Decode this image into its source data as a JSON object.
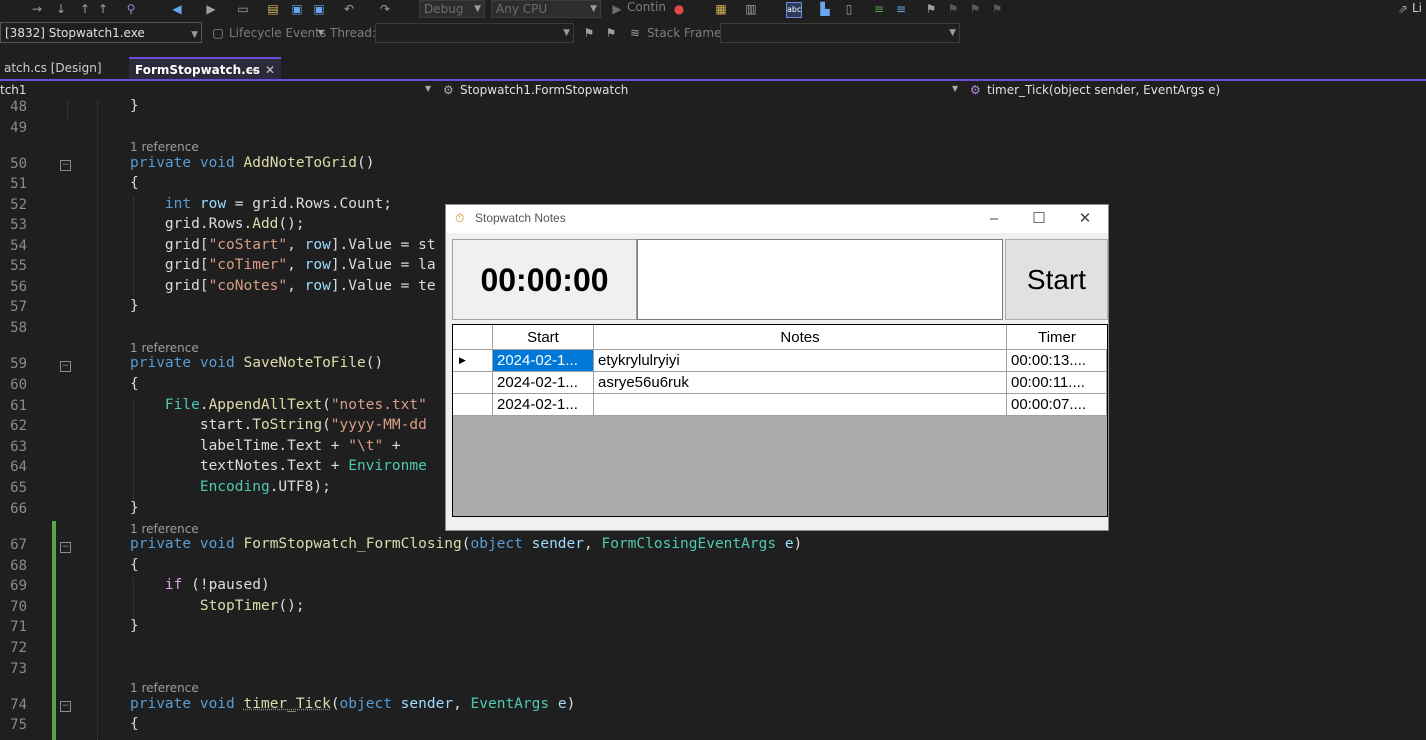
{
  "toolbar": {
    "config": "Debug",
    "platform": "Any CPU",
    "continue_label": "Contin",
    "process": "[3832] Stopwatch1.exe",
    "lifecycle": "Lifecycle Events",
    "thread_label": "Thread:",
    "stack_frame_label": "Stack Frame:",
    "right_label": "Li"
  },
  "tabs": [
    {
      "label": "atch.cs [Design]"
    },
    {
      "label": "FormStopwatch.cs"
    }
  ],
  "navbar": {
    "project": "tch1",
    "class": "Stopwatch1.FormStopwatch",
    "member": "timer_Tick(object sender, EventArgs e)"
  },
  "code": {
    "line_numbers": [
      "48",
      "49",
      "50",
      "51",
      "52",
      "53",
      "54",
      "55",
      "56",
      "57",
      "58",
      "59",
      "60",
      "61",
      "62",
      "63",
      "64",
      "65",
      "66",
      "67",
      "68",
      "69",
      "70",
      "71",
      "72",
      "73",
      "74",
      "75"
    ],
    "references": [
      "1 reference",
      "1 reference",
      "1 reference",
      "1 reference"
    ]
  },
  "window": {
    "title": "Stopwatch Notes",
    "time": "00:00:00",
    "start_button": "Start",
    "grid": {
      "columns": [
        "Start",
        "Notes",
        "Timer"
      ],
      "rows": [
        {
          "start": "2024-02-1...",
          "notes": "etykrylulryiyi",
          "timer": "00:00:13...."
        },
        {
          "start": "2024-02-1...",
          "notes": "asrye56u6ruk",
          "timer": "00:00:11...."
        },
        {
          "start": "2024-02-1...",
          "notes": "",
          "timer": "00:00:07...."
        }
      ]
    }
  }
}
